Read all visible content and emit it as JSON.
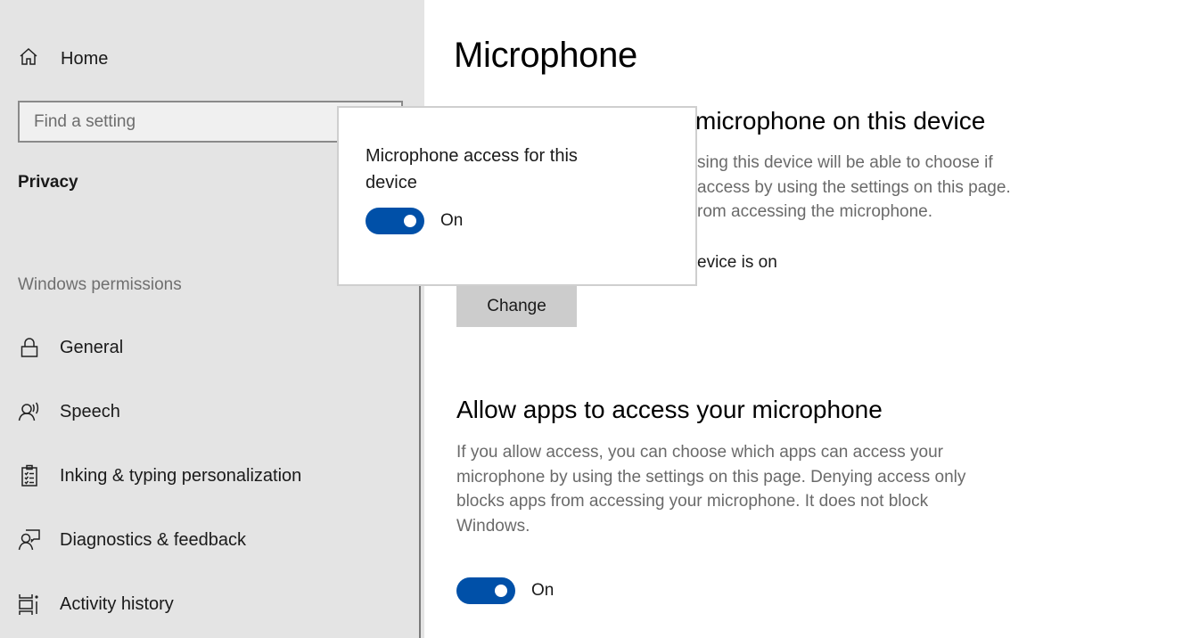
{
  "sidebar": {
    "home_label": "Home",
    "search_placeholder": "Find a setting",
    "search_value": "",
    "section_title": "Privacy",
    "group_label": "Windows permissions",
    "items": [
      {
        "label": "General",
        "icon": "lock-icon"
      },
      {
        "label": "Speech",
        "icon": "speech-icon"
      },
      {
        "label": "Inking & typing personalization",
        "icon": "clipboard-checklist-icon"
      },
      {
        "label": "Diagnostics & feedback",
        "icon": "person-feedback-icon"
      },
      {
        "label": "Activity history",
        "icon": "activity-history-icon"
      }
    ]
  },
  "main": {
    "page_title": "Microphone",
    "device_section": {
      "heading_visible": "microphone on this device",
      "desc_lines": [
        "sing this device will be able to choose if",
        "access by using the settings on this page.",
        "rom accessing the microphone."
      ],
      "status_visible": "evice is on",
      "change_button": "Change"
    },
    "apps_section": {
      "heading": "Allow apps to access your microphone",
      "desc_lines": [
        "If you allow access, you can choose which apps can access your",
        "microphone by using the settings on this page. Denying access only",
        "blocks apps from accessing your microphone. It does not block",
        "Windows."
      ],
      "toggle_state": "On",
      "toggle_on": true
    }
  },
  "flyout": {
    "title": "Microphone access for this device",
    "toggle_state": "On",
    "toggle_on": true
  },
  "colors": {
    "accent": "#0050a8",
    "sidebar_bg": "#e4e4e4",
    "button_bg": "#cccccc"
  }
}
